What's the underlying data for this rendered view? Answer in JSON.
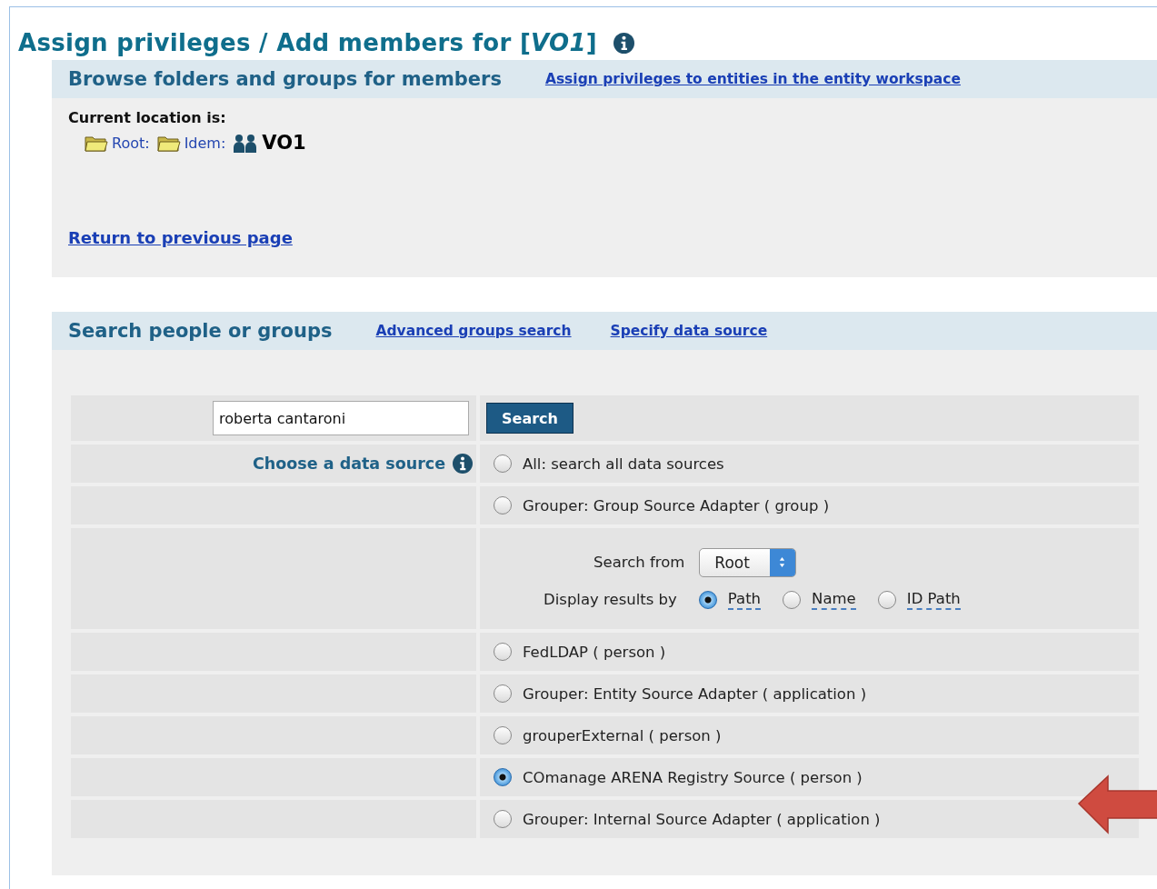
{
  "title": "Assign privileges / Add members for [*VO1*]",
  "browse": {
    "heading": "Browse folders and groups for members",
    "link": "Assign privileges to entities in the entity workspace",
    "location_label": "Current location is:",
    "path": [
      {
        "kind": "folder",
        "label": "Root:"
      },
      {
        "kind": "folder",
        "label": "Idem:"
      },
      {
        "kind": "group",
        "label": "VO1"
      }
    ],
    "return_link": "Return to previous page"
  },
  "search": {
    "heading": "Search people or groups",
    "links": [
      "Advanced groups search",
      "Specify data source"
    ],
    "query": "roberta cantaroni",
    "button": "Search",
    "choose_label": "Choose a data source",
    "rows": [
      {
        "kind": "source",
        "label": "All: search all data sources",
        "selected": false
      },
      {
        "kind": "source",
        "label": "Grouper: Group Source Adapter ( group )",
        "selected": false
      },
      {
        "kind": "options",
        "search_from_label": "Search from",
        "search_from_value": "Root",
        "display_label": "Display results by",
        "display_options": [
          {
            "label": "Path",
            "selected": true
          },
          {
            "label": "Name",
            "selected": false
          },
          {
            "label": "ID Path",
            "selected": false
          }
        ]
      },
      {
        "kind": "source",
        "label": "FedLDAP ( person )",
        "selected": false
      },
      {
        "kind": "source",
        "label": "Grouper: Entity Source Adapter ( application )",
        "selected": false
      },
      {
        "kind": "source",
        "label": "grouperExternal ( person )",
        "selected": false
      },
      {
        "kind": "source",
        "label": "COmanage ARENA Registry Source ( person )",
        "selected": true
      },
      {
        "kind": "source",
        "label": "Grouper: Internal Source Adapter ( application )",
        "selected": false
      }
    ]
  }
}
